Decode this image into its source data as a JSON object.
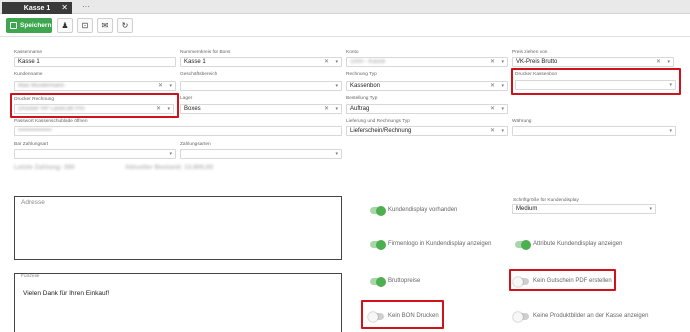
{
  "tabs": {
    "active": "Kasse 1",
    "more": "···"
  },
  "toolbar": {
    "save_label": "Speichern"
  },
  "fields": {
    "kassenname": {
      "label": "Kassenname",
      "value": "Kasse 1"
    },
    "nummernkreis": {
      "label": "Nummernkreis für Bons",
      "value": "Kasse 1"
    },
    "konto": {
      "label": "Konto",
      "value": "1000 - Kasse"
    },
    "vk_preis": {
      "label": "Preis ziehen von",
      "value": "VK-Preis Brutto"
    },
    "kundenname": {
      "label": "Kundenname",
      "value": "Max Mustermann"
    },
    "geschaeftsbereich": {
      "label": "Geschäftsbereich",
      "value": ""
    },
    "rechnung_typ": {
      "label": "Rechnung Typ",
      "value": "Kassenbon"
    },
    "drucker_kassenbon": {
      "label": "Drucker Kassenbon",
      "value": ""
    },
    "drucker_rechnung": {
      "label": "Drucker Rechnung",
      "value": "Drucker HP LaserJet Pro"
    },
    "lager": {
      "label": "Lager",
      "value": "Boxes"
    },
    "bestellung_typ": {
      "label": "Bestellung Typ",
      "value": "Auftrag"
    },
    "passwort": {
      "label": "Passwort Kassenschublade öffnen",
      "value": "••••••••••••••••"
    },
    "lieferung": {
      "label": "Lieferung und Rechnungs Typ",
      "value": "Lieferschein/Rechnung"
    },
    "waehrung": {
      "label": "Währung",
      "value": ""
    },
    "bar_zahlungsart": {
      "label": "Bar Zahlungsart",
      "value": ""
    },
    "zahlungsarten": {
      "label": "Zahlungsarten",
      "value": ""
    },
    "schriftgroesse": {
      "label": "Schriftgröße für Kundendisplay",
      "value": "Medium"
    }
  },
  "summary": {
    "last_payment": "Letzte Zahlung: 300",
    "current_stock": "Aktueller Bestand: 13.800,00"
  },
  "adresse": {
    "label": "Adresse"
  },
  "fusszeile": {
    "label": "Fußzeile",
    "text": "Vielen Dank für Ihren Einkauf!"
  },
  "toggles": {
    "kundendisplay": {
      "label": "Kundendisplay vorhanden",
      "on": true
    },
    "firmenlogo": {
      "label": "Firmenlogo in Kundendisplay anzeigen",
      "on": true
    },
    "attribute": {
      "label": "Attribute Kundendisplay anzeigen",
      "on": true
    },
    "bruttopreise": {
      "label": "Bruttopreise",
      "on": true
    },
    "gutschein": {
      "label": "Kein Gutschein PDF erstellen",
      "on": false
    },
    "bon": {
      "label": "Kein BON Drucken",
      "on": false
    },
    "produktbilder": {
      "label": "Keine Produktbilder an der Kasse anzeigen",
      "on": false
    }
  },
  "colors": {
    "save_green": "#3da64e",
    "highlight_red": "#d0121a",
    "toggle_on": "#4caf50"
  }
}
